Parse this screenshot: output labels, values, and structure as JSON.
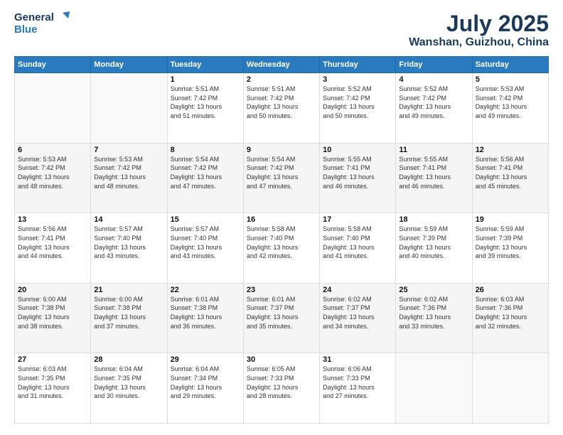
{
  "header": {
    "logo_line1": "General",
    "logo_line2": "Blue",
    "month": "July 2025",
    "location": "Wanshan, Guizhou, China"
  },
  "weekdays": [
    "Sunday",
    "Monday",
    "Tuesday",
    "Wednesday",
    "Thursday",
    "Friday",
    "Saturday"
  ],
  "weeks": [
    [
      {
        "day": "",
        "info": ""
      },
      {
        "day": "",
        "info": ""
      },
      {
        "day": "1",
        "info": "Sunrise: 5:51 AM\nSunset: 7:42 PM\nDaylight: 13 hours\nand 51 minutes."
      },
      {
        "day": "2",
        "info": "Sunrise: 5:51 AM\nSunset: 7:42 PM\nDaylight: 13 hours\nand 50 minutes."
      },
      {
        "day": "3",
        "info": "Sunrise: 5:52 AM\nSunset: 7:42 PM\nDaylight: 13 hours\nand 50 minutes."
      },
      {
        "day": "4",
        "info": "Sunrise: 5:52 AM\nSunset: 7:42 PM\nDaylight: 13 hours\nand 49 minutes."
      },
      {
        "day": "5",
        "info": "Sunrise: 5:53 AM\nSunset: 7:42 PM\nDaylight: 13 hours\nand 49 minutes."
      }
    ],
    [
      {
        "day": "6",
        "info": "Sunrise: 5:53 AM\nSunset: 7:42 PM\nDaylight: 13 hours\nand 48 minutes."
      },
      {
        "day": "7",
        "info": "Sunrise: 5:53 AM\nSunset: 7:42 PM\nDaylight: 13 hours\nand 48 minutes."
      },
      {
        "day": "8",
        "info": "Sunrise: 5:54 AM\nSunset: 7:42 PM\nDaylight: 13 hours\nand 47 minutes."
      },
      {
        "day": "9",
        "info": "Sunrise: 5:54 AM\nSunset: 7:42 PM\nDaylight: 13 hours\nand 47 minutes."
      },
      {
        "day": "10",
        "info": "Sunrise: 5:55 AM\nSunset: 7:41 PM\nDaylight: 13 hours\nand 46 minutes."
      },
      {
        "day": "11",
        "info": "Sunrise: 5:55 AM\nSunset: 7:41 PM\nDaylight: 13 hours\nand 46 minutes."
      },
      {
        "day": "12",
        "info": "Sunrise: 5:56 AM\nSunset: 7:41 PM\nDaylight: 13 hours\nand 45 minutes."
      }
    ],
    [
      {
        "day": "13",
        "info": "Sunrise: 5:56 AM\nSunset: 7:41 PM\nDaylight: 13 hours\nand 44 minutes."
      },
      {
        "day": "14",
        "info": "Sunrise: 5:57 AM\nSunset: 7:40 PM\nDaylight: 13 hours\nand 43 minutes."
      },
      {
        "day": "15",
        "info": "Sunrise: 5:57 AM\nSunset: 7:40 PM\nDaylight: 13 hours\nand 43 minutes."
      },
      {
        "day": "16",
        "info": "Sunrise: 5:58 AM\nSunset: 7:40 PM\nDaylight: 13 hours\nand 42 minutes."
      },
      {
        "day": "17",
        "info": "Sunrise: 5:58 AM\nSunset: 7:40 PM\nDaylight: 13 hours\nand 41 minutes."
      },
      {
        "day": "18",
        "info": "Sunrise: 5:59 AM\nSunset: 7:39 PM\nDaylight: 13 hours\nand 40 minutes."
      },
      {
        "day": "19",
        "info": "Sunrise: 5:59 AM\nSunset: 7:39 PM\nDaylight: 13 hours\nand 39 minutes."
      }
    ],
    [
      {
        "day": "20",
        "info": "Sunrise: 6:00 AM\nSunset: 7:38 PM\nDaylight: 13 hours\nand 38 minutes."
      },
      {
        "day": "21",
        "info": "Sunrise: 6:00 AM\nSunset: 7:38 PM\nDaylight: 13 hours\nand 37 minutes."
      },
      {
        "day": "22",
        "info": "Sunrise: 6:01 AM\nSunset: 7:38 PM\nDaylight: 13 hours\nand 36 minutes."
      },
      {
        "day": "23",
        "info": "Sunrise: 6:01 AM\nSunset: 7:37 PM\nDaylight: 13 hours\nand 35 minutes."
      },
      {
        "day": "24",
        "info": "Sunrise: 6:02 AM\nSunset: 7:37 PM\nDaylight: 13 hours\nand 34 minutes."
      },
      {
        "day": "25",
        "info": "Sunrise: 6:02 AM\nSunset: 7:36 PM\nDaylight: 13 hours\nand 33 minutes."
      },
      {
        "day": "26",
        "info": "Sunrise: 6:03 AM\nSunset: 7:36 PM\nDaylight: 13 hours\nand 32 minutes."
      }
    ],
    [
      {
        "day": "27",
        "info": "Sunrise: 6:03 AM\nSunset: 7:35 PM\nDaylight: 13 hours\nand 31 minutes."
      },
      {
        "day": "28",
        "info": "Sunrise: 6:04 AM\nSunset: 7:35 PM\nDaylight: 13 hours\nand 30 minutes."
      },
      {
        "day": "29",
        "info": "Sunrise: 6:04 AM\nSunset: 7:34 PM\nDaylight: 13 hours\nand 29 minutes."
      },
      {
        "day": "30",
        "info": "Sunrise: 6:05 AM\nSunset: 7:33 PM\nDaylight: 13 hours\nand 28 minutes."
      },
      {
        "day": "31",
        "info": "Sunrise: 6:06 AM\nSunset: 7:33 PM\nDaylight: 13 hours\nand 27 minutes."
      },
      {
        "day": "",
        "info": ""
      },
      {
        "day": "",
        "info": ""
      }
    ]
  ]
}
